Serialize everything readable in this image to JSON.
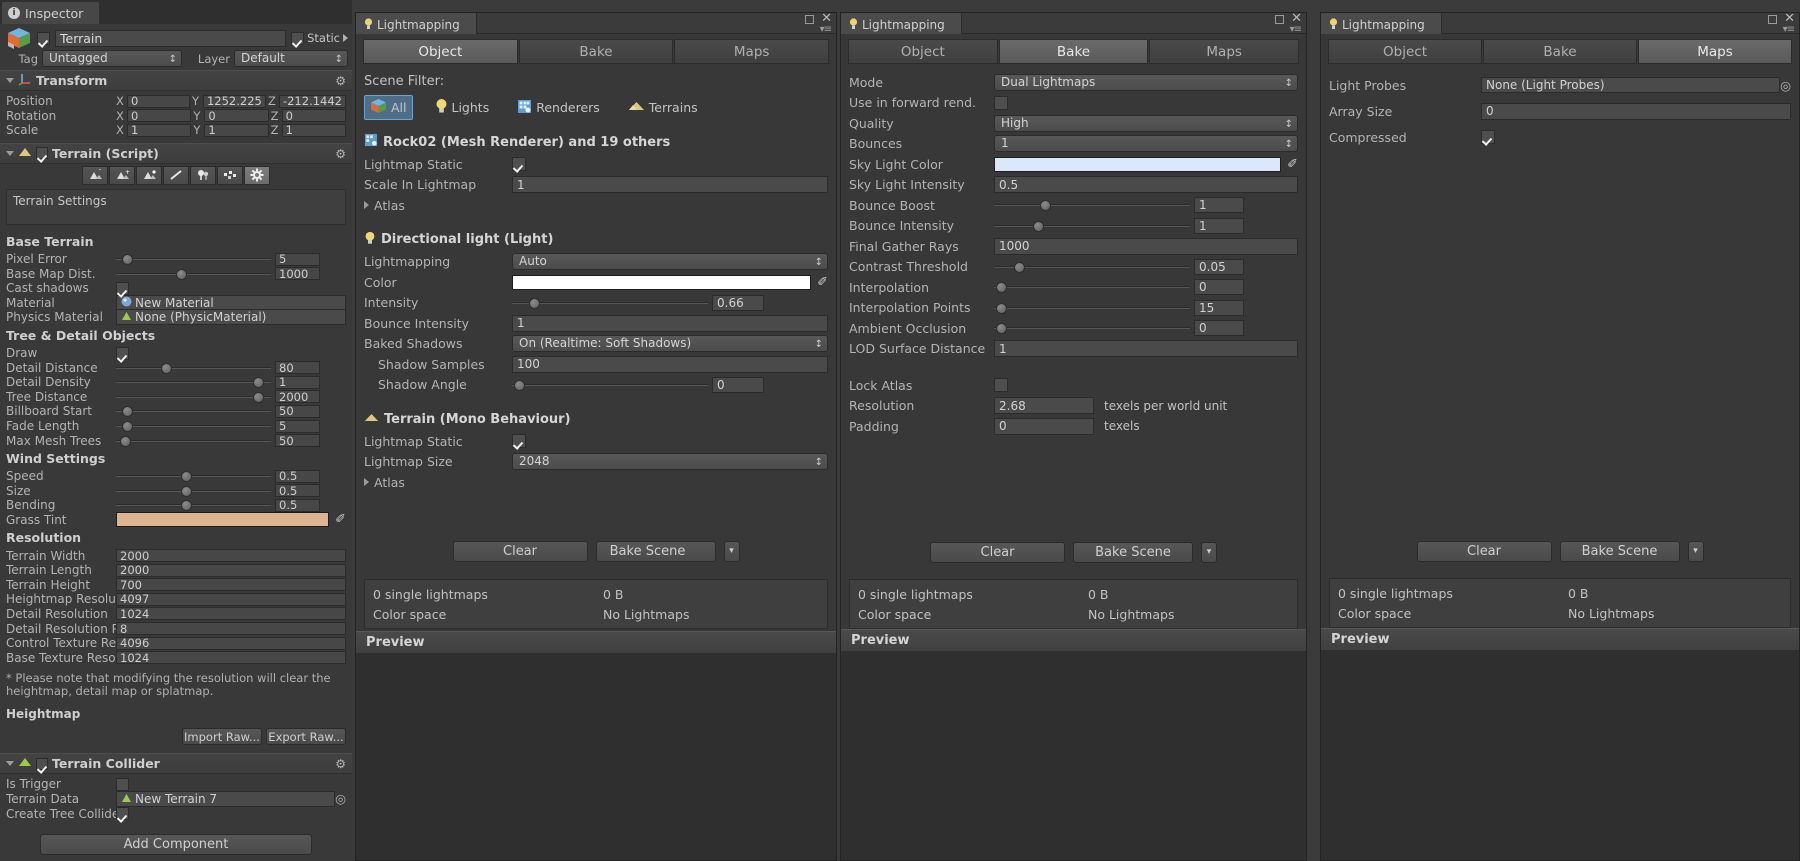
{
  "inspector": {
    "tab_label": "Inspector",
    "object_name": "Terrain",
    "static_label": "Static",
    "static_checked": true,
    "tag_label": "Tag",
    "tag_value": "Untagged",
    "layer_label": "Layer",
    "layer_value": "Default",
    "transform": {
      "title": "Transform",
      "rows": [
        {
          "label": "Position",
          "x": "0",
          "y": "1252.225",
          "z": "-212.1442"
        },
        {
          "label": "Rotation",
          "x": "0",
          "y": "0",
          "z": "0"
        },
        {
          "label": "Scale",
          "x": "1",
          "y": "1",
          "z": "1"
        }
      ],
      "axis_x": "X",
      "axis_y": "Y",
      "axis_z": "Z"
    },
    "terrain_script": {
      "title": "Terrain (Script)",
      "enabled": true,
      "tools": [
        "raise-lower-terrain-icon",
        "paint-height-icon",
        "smooth-height-icon",
        "paint-texture-icon",
        "place-trees-icon",
        "paint-details-icon",
        "terrain-settings-icon"
      ],
      "selected_tool_index": 6,
      "panel_title": "Terrain Settings",
      "sections": [
        {
          "header": "Base Terrain",
          "rows": [
            {
              "label": "Pixel Error",
              "type": "slider",
              "value": "5",
              "pos": 0.04
            },
            {
              "label": "Base Map Dist.",
              "type": "slider",
              "value": "1000",
              "pos": 0.42
            },
            {
              "label": "Cast shadows",
              "type": "checkbox",
              "checked": true
            },
            {
              "label": "Material",
              "type": "object",
              "value": "New Material",
              "icon": "material-icon"
            },
            {
              "label": "Physics Material",
              "type": "object",
              "value": "None (PhysicMaterial)",
              "icon": "physic-material-icon"
            }
          ]
        },
        {
          "header": "Tree & Detail Objects",
          "rows": [
            {
              "label": "Draw",
              "type": "checkbox",
              "checked": true
            },
            {
              "label": "Detail Distance",
              "type": "slider",
              "value": "80",
              "pos": 0.31
            },
            {
              "label": "Detail Density",
              "type": "slider",
              "value": "1",
              "pos": 0.95
            },
            {
              "label": "Tree Distance",
              "type": "slider",
              "value": "2000",
              "pos": 0.95
            },
            {
              "label": "Billboard Start",
              "type": "slider",
              "value": "50",
              "pos": 0.04
            },
            {
              "label": "Fade Length",
              "type": "slider",
              "value": "5",
              "pos": 0.04
            },
            {
              "label": "Max Mesh Trees",
              "type": "slider",
              "value": "50",
              "pos": 0.03
            }
          ]
        },
        {
          "header": "Wind Settings",
          "rows": [
            {
              "label": "Speed",
              "type": "slider",
              "value": "0.5",
              "pos": 0.45
            },
            {
              "label": "Size",
              "type": "slider",
              "value": "0.5",
              "pos": 0.45
            },
            {
              "label": "Bending",
              "type": "slider",
              "value": "0.5",
              "pos": 0.45
            },
            {
              "label": "Grass Tint",
              "type": "color",
              "color": "#dcb492"
            }
          ]
        },
        {
          "header": "Resolution",
          "rows": [
            {
              "label": "Terrain Width",
              "type": "text",
              "value": "2000"
            },
            {
              "label": "Terrain Length",
              "type": "text",
              "value": "2000"
            },
            {
              "label": "Terrain Height",
              "type": "text",
              "value": "700"
            },
            {
              "label": "Heightmap Resolution",
              "type": "text",
              "value": "4097"
            },
            {
              "label": "Detail Resolution",
              "type": "text",
              "value": "1024"
            },
            {
              "label": "Detail Resolution Per P.",
              "type": "text",
              "value": "8"
            },
            {
              "label": "Control Texture Resolu",
              "type": "text",
              "value": "4096"
            },
            {
              "label": "Base Texture Resolutio",
              "type": "text",
              "value": "1024"
            }
          ]
        }
      ],
      "note": "* Please note that modifying the resolution will clear the heightmap, detail map or splatmap.",
      "heightmap_header": "Heightmap",
      "import_raw_label": "Import Raw...",
      "export_raw_label": "Export Raw..."
    },
    "terrain_collider": {
      "title": "Terrain Collider",
      "enabled": true,
      "rows": [
        {
          "label": "Is Trigger",
          "type": "checkbox",
          "checked": false
        },
        {
          "label": "Terrain Data",
          "type": "object",
          "value": "New Terrain 7",
          "icon": "terrain-icon"
        },
        {
          "label": "Create Tree Colliders",
          "type": "checkbox",
          "checked": true
        }
      ]
    },
    "add_component_label": "Add Component"
  },
  "lightmapping_common": {
    "window_title": "Lightmapping",
    "tabs": [
      "Object",
      "Bake",
      "Maps"
    ],
    "clear_label": "Clear",
    "bake_label": "Bake Scene",
    "status": {
      "lightmaps_count": "0 single lightmaps",
      "size": "0 B",
      "color_space_label": "Color space",
      "color_space_value": "No Lightmaps"
    },
    "preview_label": "Preview"
  },
  "window_object": {
    "active_tab": "Object",
    "scene_filter_label": "Scene Filter:",
    "filters": [
      {
        "label": "All",
        "icon": "cube-icon",
        "selected": true
      },
      {
        "label": "Lights",
        "icon": "light-bulb-icon",
        "selected": false
      },
      {
        "label": "Renderers",
        "icon": "mesh-renderer-icon",
        "selected": false
      },
      {
        "label": "Terrains",
        "icon": "terrain-icon",
        "selected": false
      }
    ],
    "groups": [
      {
        "title": "Rock02 (Mesh Renderer) and 19 others",
        "icon": "mesh-renderer-icon",
        "rows": [
          {
            "label": "Lightmap Static",
            "type": "checkbox",
            "checked": true
          },
          {
            "label": "Scale In Lightmap",
            "type": "text",
            "value": "1"
          },
          {
            "label": "Atlas",
            "type": "foldout"
          }
        ]
      },
      {
        "title": "Directional light (Light)",
        "icon": "light-bulb-icon",
        "rows": [
          {
            "label": "Lightmapping",
            "type": "popup",
            "value": "Auto"
          },
          {
            "label": "Color",
            "type": "color",
            "color": "#ffffff"
          },
          {
            "label": "Intensity",
            "type": "slider",
            "value": "0.66",
            "pos": 0.09
          },
          {
            "label": "Bounce Intensity",
            "type": "text",
            "value": "1"
          },
          {
            "label": "Baked Shadows",
            "type": "popup",
            "value": "On (Realtime: Soft Shadows)"
          },
          {
            "label": "Shadow Samples",
            "type": "text",
            "value": "100",
            "indent": true
          },
          {
            "label": "Shadow Angle",
            "type": "slider",
            "value": "0",
            "pos": 0.01,
            "indent": true
          }
        ]
      },
      {
        "title": "Terrain (Mono Behaviour)",
        "icon": "terrain-icon",
        "rows": [
          {
            "label": "Lightmap Static",
            "type": "checkbox",
            "checked": true
          },
          {
            "label": "Lightmap Size",
            "type": "popup",
            "value": "2048"
          },
          {
            "label": "Atlas",
            "type": "foldout"
          }
        ]
      }
    ]
  },
  "window_bake": {
    "active_tab": "Bake",
    "rows": [
      {
        "label": "Mode",
        "type": "popup",
        "value": "Dual Lightmaps"
      },
      {
        "label": "Use in forward rend.",
        "type": "checkbox",
        "checked": false
      },
      {
        "label": "Quality",
        "type": "popup",
        "value": "High"
      },
      {
        "label": "Bounces",
        "type": "popup",
        "value": "1"
      },
      {
        "label": "Sky Light Color",
        "type": "color",
        "color": "#dce8fa"
      },
      {
        "label": "Sky Light Intensity",
        "type": "text",
        "value": "0.5"
      },
      {
        "label": "Bounce Boost",
        "type": "slider",
        "value": "1",
        "pos": 0.25
      },
      {
        "label": "Bounce Intensity",
        "type": "slider",
        "value": "1",
        "pos": 0.21
      },
      {
        "label": "Final Gather Rays",
        "type": "text",
        "value": "1000"
      },
      {
        "label": "Contrast Threshold",
        "type": "slider",
        "value": "0.05",
        "pos": 0.11
      },
      {
        "label": "Interpolation",
        "type": "slider",
        "value": "0",
        "pos": 0.01
      },
      {
        "label": "Interpolation Points",
        "type": "slider",
        "value": "15",
        "pos": 0.01
      },
      {
        "label": "Ambient Occlusion",
        "type": "slider",
        "value": "0",
        "pos": 0.01
      },
      {
        "label": "LOD Surface Distance",
        "type": "text",
        "value": "1"
      }
    ],
    "rows2": [
      {
        "label": "Lock Atlas",
        "type": "checkbox",
        "checked": false
      },
      {
        "label": "Resolution",
        "type": "text",
        "value": "2.68",
        "suffix": "texels per world unit"
      },
      {
        "label": "Padding",
        "type": "text",
        "value": "0",
        "suffix": "texels"
      }
    ]
  },
  "window_maps": {
    "active_tab": "Maps",
    "rows": [
      {
        "label": "Light Probes",
        "type": "object",
        "value": "None (Light Probes)"
      },
      {
        "label": "Array Size",
        "type": "text",
        "value": "0"
      },
      {
        "label": "Compressed",
        "type": "checkbox",
        "checked": true
      }
    ]
  }
}
